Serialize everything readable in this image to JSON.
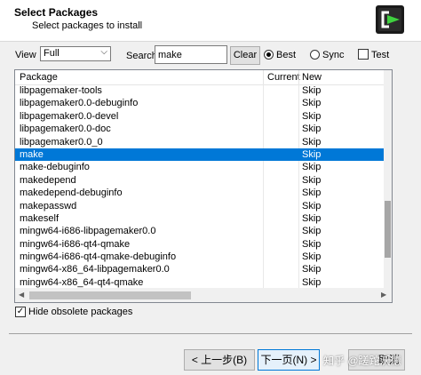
{
  "header": {
    "title": "Select Packages",
    "subtitle": "Select packages to install",
    "logo_icon": "cygwin-logo-icon"
  },
  "toolbar": {
    "view_label": "View",
    "view_value": "Full",
    "search_label": "Search",
    "search_value": "make",
    "clear_label": "Clear",
    "radio_best": "Best",
    "radio_sync": "Sync",
    "radio_selected": "Best",
    "test_label": "Test",
    "test_checked": false
  },
  "table": {
    "columns": [
      "Package",
      "Current",
      "New"
    ],
    "rows": [
      {
        "package": "libpagemaker-tools",
        "current": "",
        "new": "Skip"
      },
      {
        "package": "libpagemaker0.0-debuginfo",
        "current": "",
        "new": "Skip"
      },
      {
        "package": "libpagemaker0.0-devel",
        "current": "",
        "new": "Skip"
      },
      {
        "package": "libpagemaker0.0-doc",
        "current": "",
        "new": "Skip"
      },
      {
        "package": "libpagemaker0.0_0",
        "current": "",
        "new": "Skip"
      },
      {
        "package": "make",
        "current": "",
        "new": "Skip"
      },
      {
        "package": "make-debuginfo",
        "current": "",
        "new": "Skip"
      },
      {
        "package": "makedepend",
        "current": "",
        "new": "Skip"
      },
      {
        "package": "makedepend-debuginfo",
        "current": "",
        "new": "Skip"
      },
      {
        "package": "makepasswd",
        "current": "",
        "new": "Skip"
      },
      {
        "package": "makeself",
        "current": "",
        "new": "Skip"
      },
      {
        "package": "mingw64-i686-libpagemaker0.0",
        "current": "",
        "new": "Skip"
      },
      {
        "package": "mingw64-i686-qt4-qmake",
        "current": "",
        "new": "Skip"
      },
      {
        "package": "mingw64-i686-qt4-qmake-debuginfo",
        "current": "",
        "new": "Skip"
      },
      {
        "package": "mingw64-x86_64-libpagemaker0.0",
        "current": "",
        "new": "Skip"
      },
      {
        "package": "mingw64-x86_64-qt4-qmake",
        "current": "",
        "new": "Skip"
      }
    ],
    "selected_index": 5
  },
  "footer": {
    "hide_obsolete_label": "Hide obsolete packages",
    "hide_obsolete_checked": true,
    "back_label": "< 上一步(B)",
    "next_label": "下一页(N) >",
    "cancel_label": "取消"
  },
  "watermark": "知乎 @蹉跎沃德",
  "colors": {
    "selection": "#0078d7",
    "background": "#f0f0f0",
    "logo_green": "#3fd13f"
  }
}
